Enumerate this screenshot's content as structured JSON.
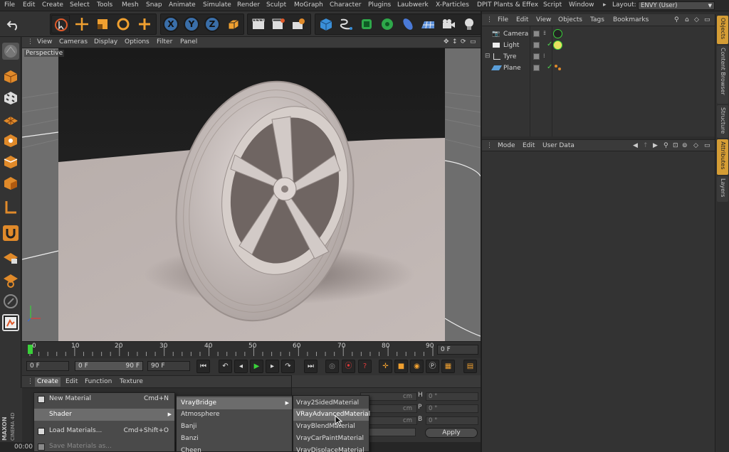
{
  "menubar": {
    "items": [
      "File",
      "Edit",
      "Create",
      "Select",
      "Tools",
      "Mesh",
      "Snap",
      "Animate",
      "Simulate",
      "Render",
      "Sculpt",
      "MoGraph",
      "Character",
      "Plugins",
      "Laubwerk",
      "X-Particles",
      "DPIT Plants & Effex",
      "Script",
      "Window"
    ],
    "layout_label": "Layout:",
    "layout_value": "ENVY (User)"
  },
  "toolbar": {
    "icons": [
      "undo-icon",
      "live-selection-icon",
      "move-icon",
      "scale-icon",
      "rotate-icon",
      "add-icon",
      "x-axis-icon",
      "y-axis-icon",
      "z-axis-icon",
      "coordinate-system-icon",
      "render-view-icon",
      "render-picture-viewer-icon",
      "render-settings-icon",
      "cube-icon",
      "pen-spline-icon",
      "subdivision-icon",
      "cloner-icon",
      "deformer-icon",
      "floor-icon",
      "camera-icon",
      "light-icon"
    ],
    "x_label": "X",
    "y_label": "Y",
    "z_label": "Z"
  },
  "viewport": {
    "menu": [
      "View",
      "Cameras",
      "Display",
      "Options",
      "Filter",
      "Panel"
    ],
    "label": "Perspective"
  },
  "timeline": {
    "ticks": [
      "0",
      "10",
      "20",
      "30",
      "40",
      "50",
      "60",
      "70",
      "80",
      "90"
    ],
    "current_frame": "0 F"
  },
  "transport": {
    "start": "0 F",
    "range_start": "0 F",
    "range_end": "90 F",
    "end": "90 F"
  },
  "material_manager": {
    "menu": [
      "Create",
      "Edit",
      "Function",
      "Texture"
    ],
    "active_menu": "Create",
    "brand_line1": "MAXON",
    "brand_line2": "CINEMA 4D"
  },
  "create_menu": {
    "items": [
      {
        "label": "New Material",
        "shortcut": "Cmd+N"
      },
      {
        "label": "Shader",
        "shortcut": "",
        "submenu": true
      },
      {
        "label": "Load Materials...",
        "shortcut": "Cmd+Shift+O"
      },
      {
        "label": "Save Materials as...",
        "shortcut": ""
      }
    ]
  },
  "shader_menu": {
    "items": [
      "VrayBridge",
      "Atmosphere",
      "Banji",
      "Banzi",
      "Cheen"
    ]
  },
  "vray_menu": {
    "items": [
      "Vray2SidedMaterial",
      "VRayAdvancedMaterial",
      "VrayBlendMaterial",
      "VrayCarPaintMaterial",
      "VrayDisplaceMaterial"
    ],
    "highlighted": "VRayAdvancedMaterial"
  },
  "coordinates": {
    "h_label": "H",
    "p_label": "P",
    "b_label": "B",
    "h_value": "0 °",
    "p_value": "0 °",
    "b_value": "0 °",
    "unit": "cm",
    "apply_label": "Apply"
  },
  "status": {
    "time": "00:00"
  },
  "object_manager": {
    "menu": [
      "File",
      "Edit",
      "View",
      "Objects",
      "Tags",
      "Bookmarks"
    ],
    "objects": [
      {
        "name": "Camera"
      },
      {
        "name": "Light"
      },
      {
        "name": "Tyre"
      },
      {
        "name": "Plane"
      }
    ]
  },
  "attributes": {
    "menu": [
      "Mode",
      "Edit",
      "User Data"
    ]
  },
  "side_tabs": [
    "Objects",
    "Content Browser",
    "Structure",
    "Attributes",
    "Layers"
  ],
  "colors": {
    "accent_orange": "#d59d35",
    "highlight": "#6c6c6c",
    "axis_blue": "#3a6ea8"
  }
}
